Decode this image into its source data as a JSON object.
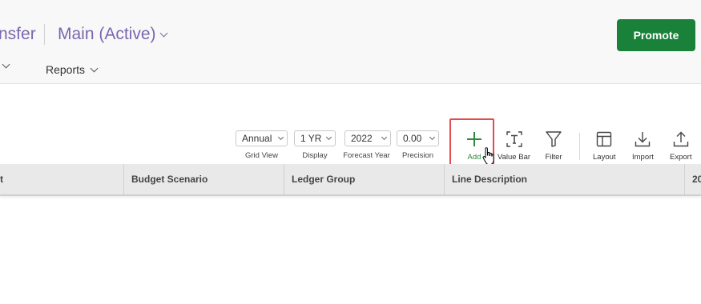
{
  "header": {
    "title_left": "nsfer",
    "scenario": "Main (Active)",
    "promote_label": "Promote",
    "nav_reports": "Reports"
  },
  "toolbar": {
    "grid_view": {
      "value": "Annual",
      "label": "Grid View"
    },
    "display": {
      "value": "1 YR",
      "label": "Display"
    },
    "forecast_year": {
      "value": "2022",
      "label": "Forecast Year"
    },
    "precision": {
      "value": "0.00",
      "label": "Precision"
    },
    "add_label": "Add",
    "value_bar_label": "Value Bar",
    "filter_label": "Filter",
    "layout_label": "Layout",
    "import_label": "Import",
    "export_label": "Export"
  },
  "grid": {
    "columns": [
      "t",
      "Budget Scenario",
      "Ledger Group",
      "Line Description",
      "20"
    ]
  },
  "colors": {
    "accent_purple": "#7a67ad",
    "promote_green": "#19813a",
    "add_green": "#2b8a3e",
    "highlight_red": "#e14d4d"
  }
}
